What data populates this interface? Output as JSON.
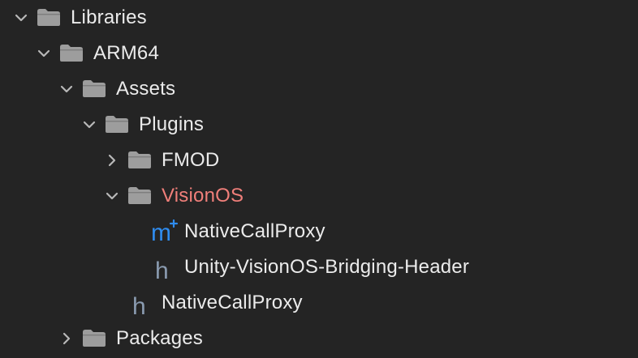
{
  "tree": {
    "libraries": {
      "label": "Libraries",
      "icon": "folder-icon",
      "expanded": true
    },
    "arm64": {
      "label": "ARM64",
      "icon": "folder-icon",
      "expanded": true
    },
    "assets": {
      "label": "Assets",
      "icon": "folder-icon",
      "expanded": true
    },
    "plugins": {
      "label": "Plugins",
      "icon": "folder-icon",
      "expanded": true
    },
    "fmod": {
      "label": "FMOD",
      "icon": "folder-icon",
      "expanded": false
    },
    "visionos": {
      "label": "VisionOS",
      "icon": "folder-icon",
      "expanded": true
    },
    "native_call_proxy_mm": {
      "label": "NativeCallProxy",
      "icon": "objc-plus-plus-file-icon",
      "badge": "m"
    },
    "bridging_header": {
      "label": "Unity-VisionOS-Bridging-Header",
      "icon": "header-file-icon",
      "badge": "h"
    },
    "native_call_proxy_h": {
      "label": "NativeCallProxy",
      "icon": "header-file-icon",
      "badge": "h"
    },
    "packages": {
      "label": "Packages",
      "icon": "folder-icon",
      "expanded": false
    }
  },
  "colors": {
    "background": "#242424",
    "text": "#ebebeb",
    "accent_label": "#f07f7a",
    "folder": "#9d9d9d",
    "chevron": "#b8b8b8",
    "objc_icon": "#2f8cef",
    "header_icon": "#8a9bb0"
  }
}
